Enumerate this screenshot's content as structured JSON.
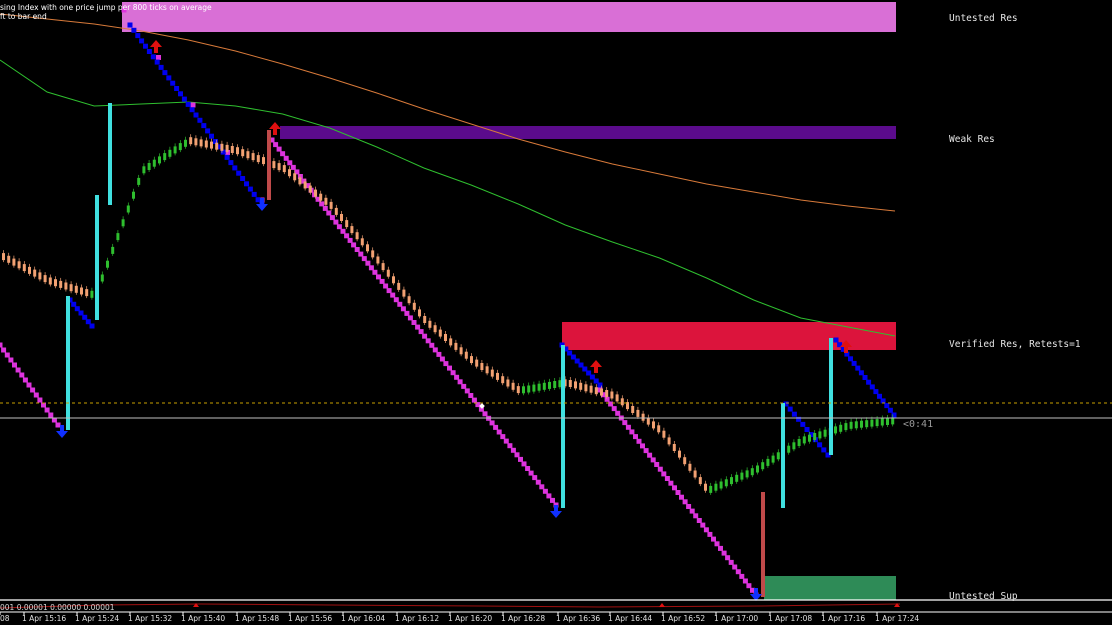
{
  "chart_data": {
    "type": "line",
    "info_lines": [
      "sing Index with one price jump per 800 ticks on average",
      "ft to bar end"
    ],
    "zones": [
      {
        "label": "Untested Res",
        "color": "#d96fd6"
      },
      {
        "label": "Weak Res",
        "color": "#5b0b8c"
      },
      {
        "label": "Verified Res, Retests=1",
        "color": "#dc143c"
      },
      {
        "label": "Untested Sup",
        "color": "#2e8b57"
      }
    ],
    "countdown": "<0:41",
    "indicator_values": "001 0.00001 0.00000 0.00001",
    "x_ticks": [
      "08",
      "1 Apr 15:16",
      "1 Apr 15:24",
      "1 Apr 15:32",
      "1 Apr 15:40",
      "1 Apr 15:48",
      "1 Apr 15:56",
      "1 Apr 16:04",
      "1 Apr 16:12",
      "1 Apr 16:20",
      "1 Apr 16:28",
      "1 Apr 16:36",
      "1 Apr 16:44",
      "1 Apr 16:52",
      "1 Apr 17:00",
      "1 Apr 17:08",
      "1 Apr 17:16",
      "1 Apr 17:24"
    ],
    "series": [
      {
        "color": "#d87a3a",
        "values": [
          -14,
          -19,
          -24,
          -31,
          -40,
          -51,
          -64,
          -78,
          -93,
          -109,
          -124,
          -139,
          -152,
          -164,
          -174,
          -184,
          -192,
          -200,
          -206,
          -211
        ]
      },
      {
        "color": "#2fbf2f",
        "values": [
          -60,
          -92,
          -106,
          -104,
          -102,
          -106,
          -114,
          -128,
          -147,
          -168,
          -185,
          -204,
          -225,
          -242,
          -258,
          -278,
          -300,
          -318,
          -327,
          -336
        ]
      },
      {
        "color": "#f2a172",
        "values": [
          -255,
          -280,
          -295,
          -170,
          -140,
          -150,
          -168,
          -205,
          -260,
          -320,
          -360,
          -390,
          -382,
          -395,
          -430,
          -490,
          -470,
          -440,
          -425,
          -420
        ]
      }
    ],
    "colors": {
      "up": "#2fbf2f",
      "down": "#f2a172",
      "renko_up": "#0000ee",
      "renko_down": "#dd33dd",
      "impulse": "#40e0e0",
      "arrow_up": "#e01010",
      "arrow_down": "#1030ff",
      "price_line": "#c0c0c0",
      "ask_line": "#c8a000"
    }
  }
}
